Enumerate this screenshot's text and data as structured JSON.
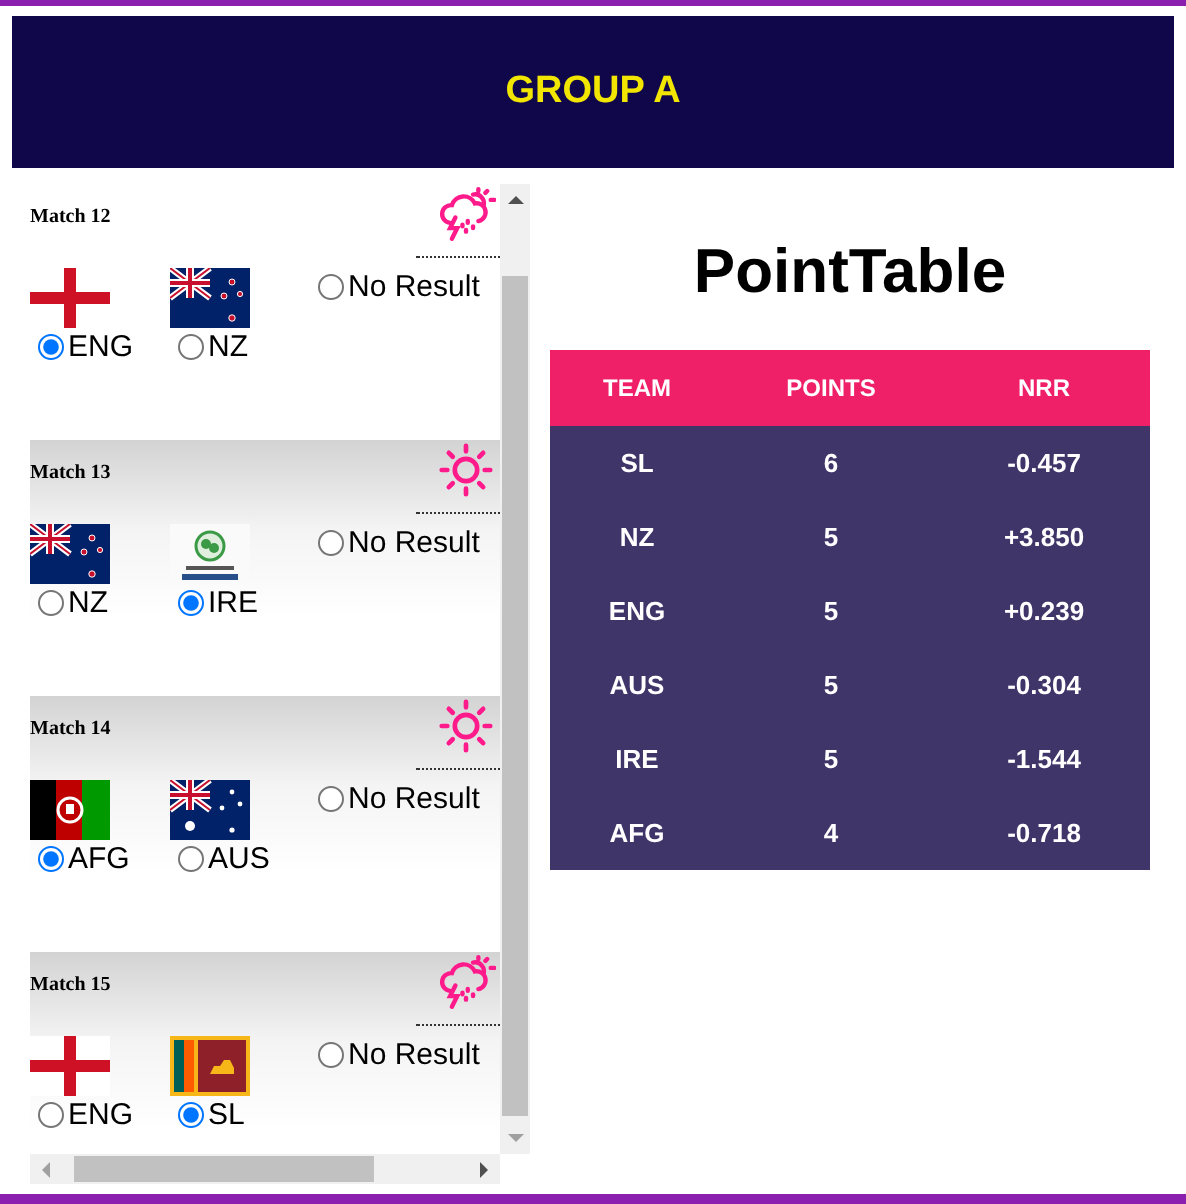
{
  "header": {
    "title": "GROUP A"
  },
  "matches": [
    {
      "title": "Match 12",
      "kind": "storm",
      "teams": [
        {
          "code": "ENG",
          "kind": "england",
          "selected": true
        },
        {
          "code": "NZ",
          "kind": "new-zealand",
          "selected": false
        }
      ],
      "no_result": {
        "label": "No Result",
        "selected": false
      }
    },
    {
      "title": "Match 13",
      "kind": "sun",
      "teams": [
        {
          "code": "NZ",
          "kind": "new-zealand",
          "selected": false
        },
        {
          "code": "IRE",
          "kind": "ireland",
          "selected": true
        }
      ],
      "no_result": {
        "label": "No Result",
        "selected": false
      }
    },
    {
      "title": "Match 14",
      "kind": "sun",
      "teams": [
        {
          "code": "AFG",
          "kind": "afghanistan",
          "selected": true
        },
        {
          "code": "AUS",
          "kind": "australia",
          "selected": false
        }
      ],
      "no_result": {
        "label": "No Result",
        "selected": false
      }
    },
    {
      "title": "Match 15",
      "kind": "storm",
      "teams": [
        {
          "code": "ENG",
          "kind": "england",
          "selected": false
        },
        {
          "code": "SL",
          "kind": "sri-lanka",
          "selected": true
        }
      ],
      "no_result": {
        "label": "No Result",
        "selected": false
      }
    }
  ],
  "point_table": {
    "title": "PointTable",
    "columns": [
      "TEAM",
      "POINTS",
      "NRR"
    ],
    "rows": [
      [
        "SL",
        "6",
        "-0.457"
      ],
      [
        "NZ",
        "5",
        "+3.850"
      ],
      [
        "ENG",
        "5",
        "+0.239"
      ],
      [
        "AUS",
        "5",
        "-0.304"
      ],
      [
        "IRE",
        "5",
        "-1.544"
      ],
      [
        "AFG",
        "4",
        "-0.718"
      ]
    ]
  }
}
